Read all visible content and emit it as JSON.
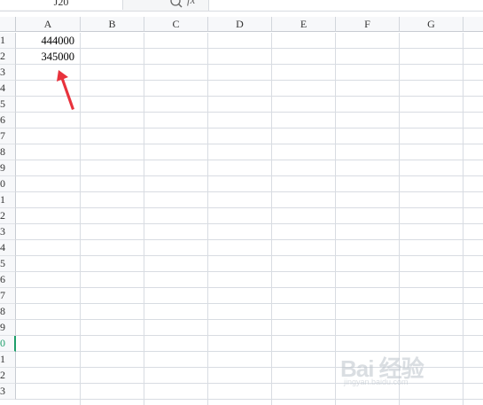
{
  "formula_bar": {
    "name_box": "J20",
    "zoom_icon": "magnifier-icon",
    "fx_label": "fx"
  },
  "columns": [
    "A",
    "B",
    "C",
    "D",
    "E",
    "F",
    "G"
  ],
  "rows": [
    "1",
    "2",
    "3",
    "4",
    "5",
    "6",
    "7",
    "8",
    "9",
    "0",
    "1",
    "2",
    "3",
    "4",
    "5",
    "6",
    "7",
    "8",
    "9",
    "0",
    "1",
    "2",
    "3"
  ],
  "cells": {
    "A1": "444000",
    "A2": "345000"
  },
  "active_row_index": 19,
  "annotation": {
    "arrow_color": "#e8323c",
    "arrow_icon": "red-arrow-icon"
  },
  "watermark": {
    "main": "Bai 经验",
    "sub": "jingyan.baidu.com"
  },
  "colors": {
    "accent": "#1e9e6a",
    "gridline": "#d8dce2",
    "header_bg": "#f7f8fa"
  }
}
